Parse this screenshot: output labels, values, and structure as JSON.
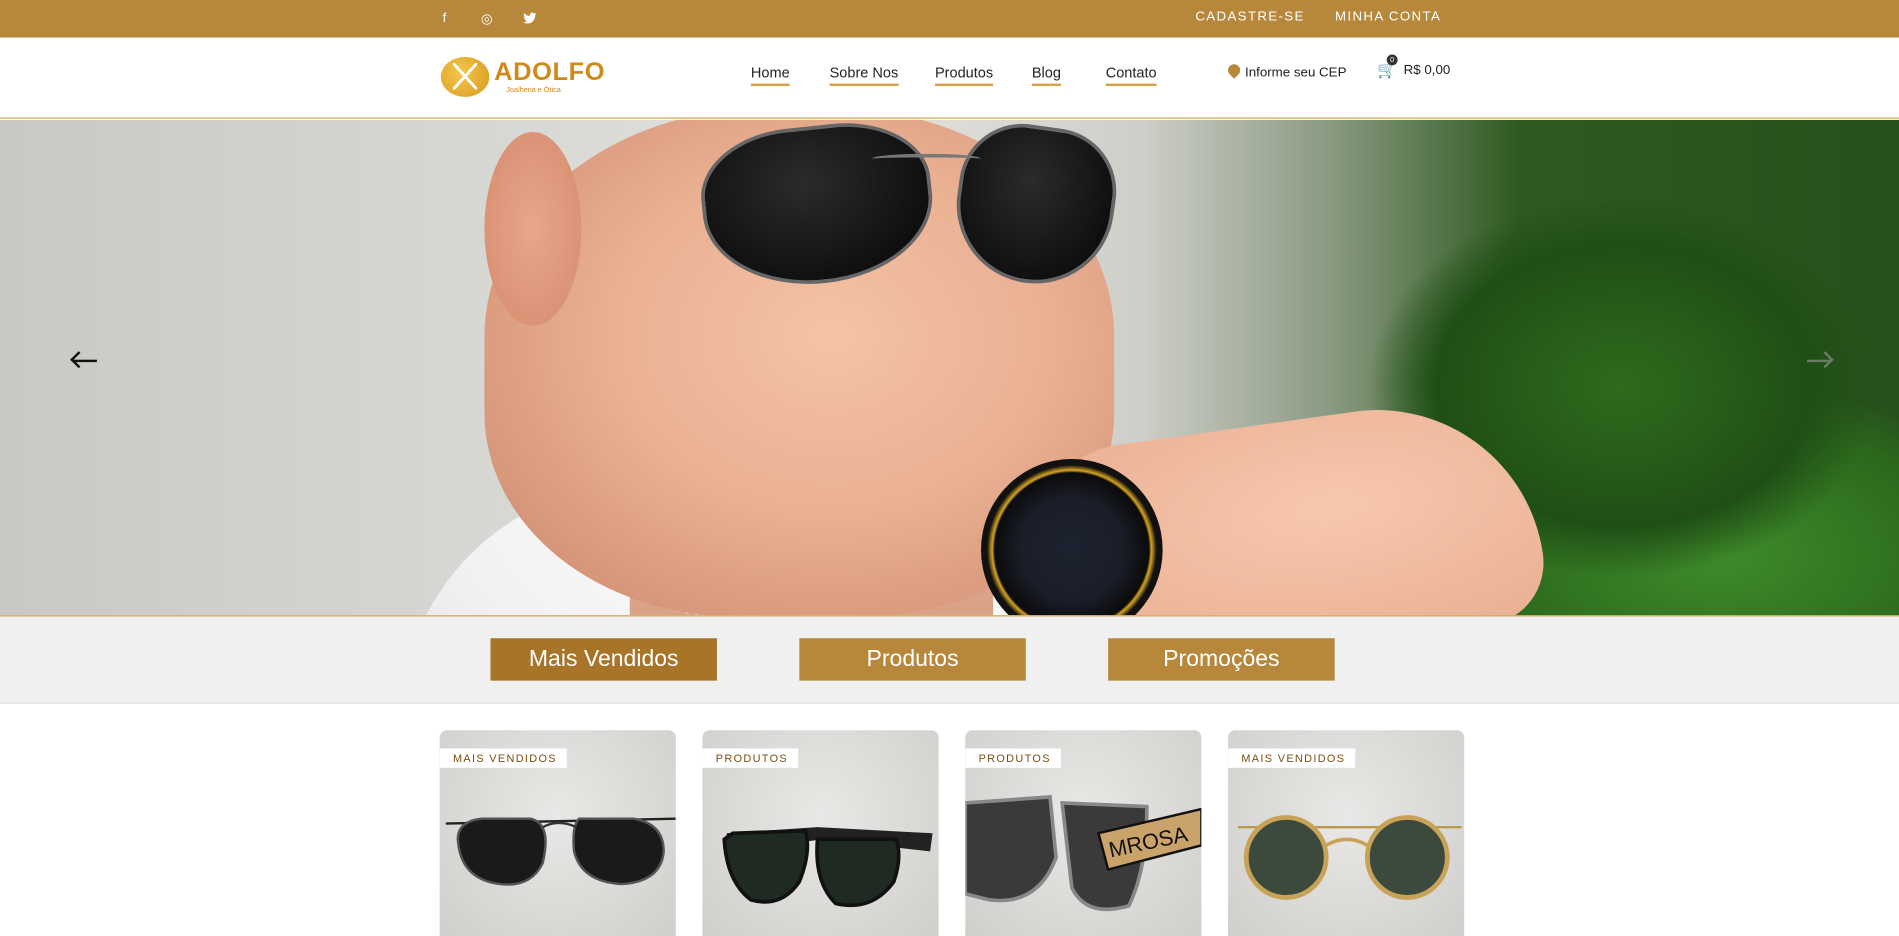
{
  "topbar": {
    "social": [
      {
        "icon": "facebook-icon",
        "glyph": "f"
      },
      {
        "icon": "instagram-icon",
        "glyph": "◎"
      },
      {
        "icon": "twitter-icon",
        "glyph": "🐦"
      }
    ],
    "links": {
      "register": "CADASTRE-SE",
      "account": "MINHA CONTA"
    }
  },
  "header": {
    "logo": {
      "name": "ADOLFO",
      "tagline": "Joalheria e Ótica"
    },
    "nav": [
      "Home",
      "Sobre Nos",
      "Produtos",
      "Blog",
      "Contato"
    ],
    "cep_label": "Informe seu CEP",
    "cart": {
      "count": "0",
      "total": "R$ 0,00"
    }
  },
  "tabs": [
    "Mais Vendidos",
    "Produtos",
    "Promoções"
  ],
  "products": [
    {
      "badge": "MAIS VENDIDOS"
    },
    {
      "badge": "PRODUTOS"
    },
    {
      "badge": "PRODUTOS"
    },
    {
      "badge": "MAIS VENDIDOS"
    }
  ],
  "colors": {
    "brand": "#b7883c",
    "brand_dark": "#a87427"
  }
}
